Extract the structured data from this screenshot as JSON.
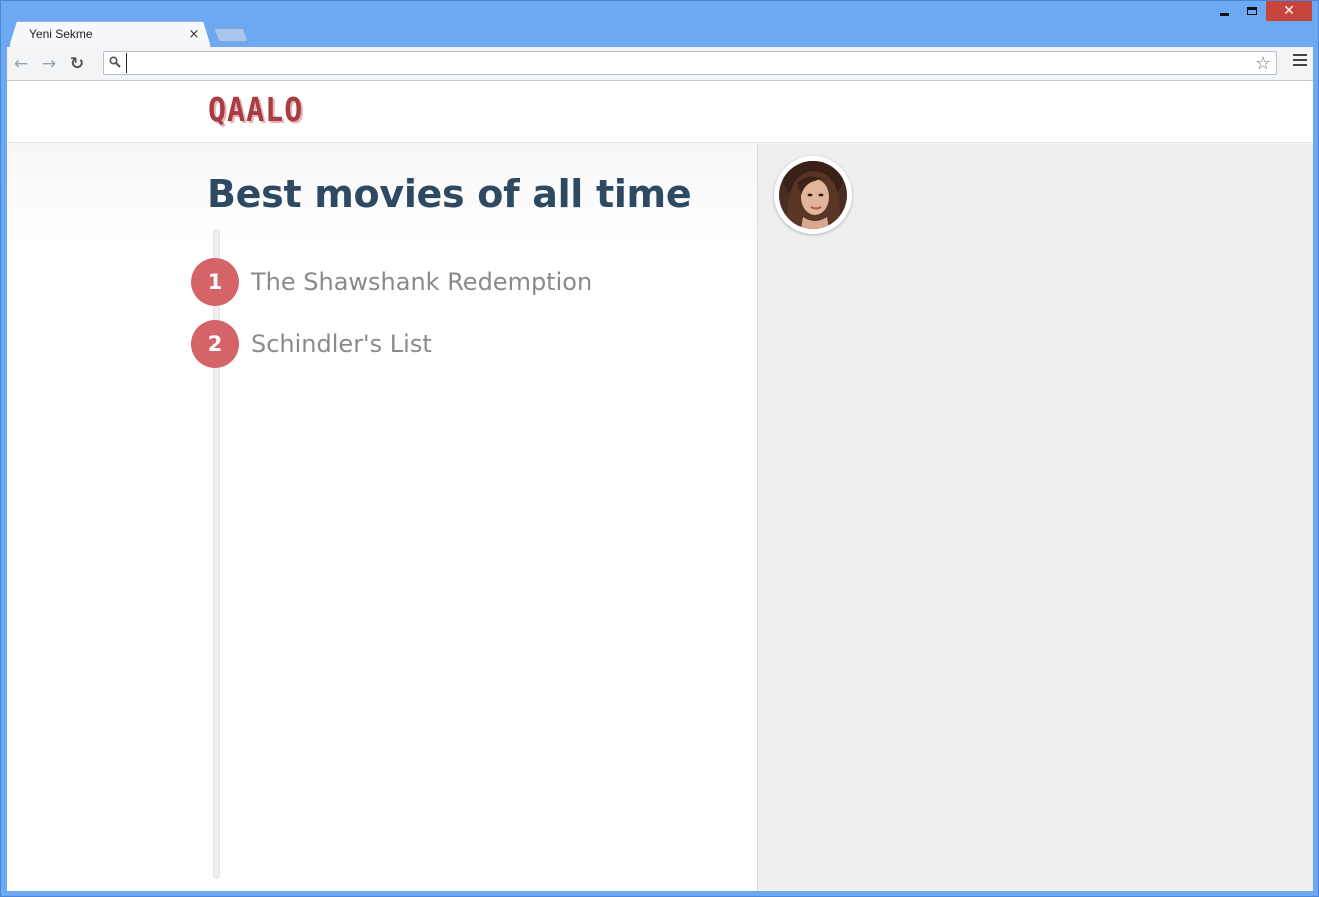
{
  "browser": {
    "tab_title": "Yeni Sekme",
    "tab_close": "×",
    "address_value": "",
    "back_glyph": "←",
    "forward_glyph": "→",
    "reload_glyph": "↻",
    "star_glyph": "☆",
    "search_glyph": "⚲",
    "close_glyph": "✕"
  },
  "site": {
    "logo": "QAALO",
    "page_title": "Best movies of all time",
    "movies": [
      {
        "rank": "1",
        "title": "The Shawshank Redemption"
      },
      {
        "rank": "2",
        "title": "Schindler's List"
      }
    ]
  },
  "colors": {
    "accent": "#d46468",
    "title": "#2e4a62",
    "logo": "#a83e43"
  }
}
